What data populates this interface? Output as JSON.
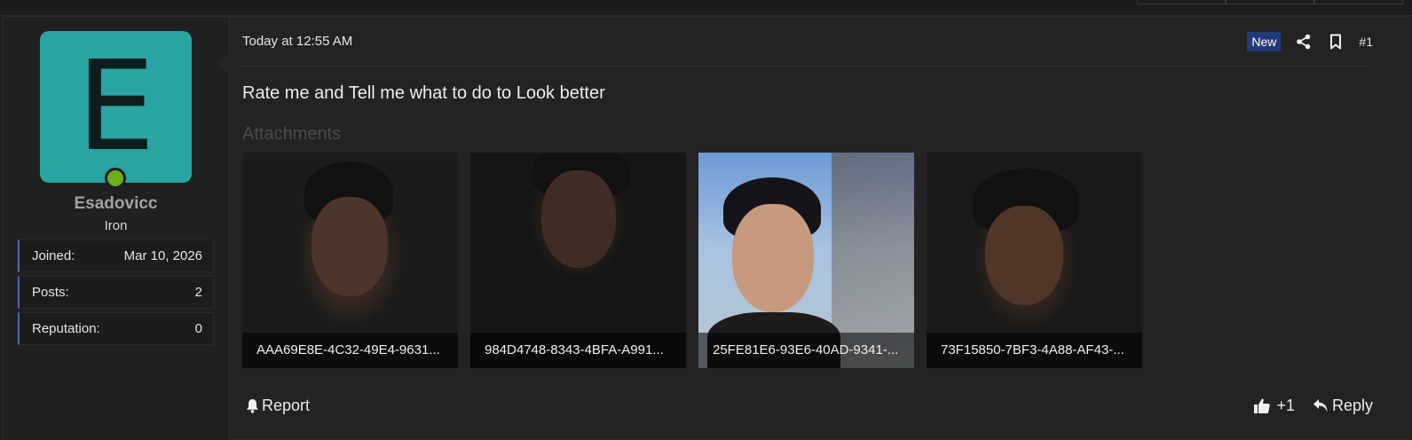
{
  "user": {
    "avatar_letter": "E",
    "avatar_color": "#29a4a2",
    "online_color": "#6aad1a",
    "username": "Esadovicc",
    "title": "Iron",
    "stats": [
      {
        "label": "Joined:",
        "value": "Mar 10, 2026"
      },
      {
        "label": "Posts:",
        "value": "2"
      },
      {
        "label": "Reputation:",
        "value": "0"
      }
    ]
  },
  "post": {
    "date": "Today at 12:55 AM",
    "new_badge": "New",
    "share_icon": "share-icon",
    "bookmark_icon": "bookmark-icon",
    "number": "#1",
    "body": "Rate me and Tell me what to do to Look better",
    "attachments_label": "Attachments",
    "attachments": [
      {
        "filename": "AAA69E8E-4C32-49E4-9631..."
      },
      {
        "filename": "984D4748-8343-4BFA-A991..."
      },
      {
        "filename": "25FE81E6-93E6-40AD-9341-..."
      },
      {
        "filename": "73F15850-7BF3-4A88-AF43-..."
      }
    ]
  },
  "actions": {
    "report_label": "Report",
    "like_label": "+1",
    "reply_label": "Reply"
  }
}
